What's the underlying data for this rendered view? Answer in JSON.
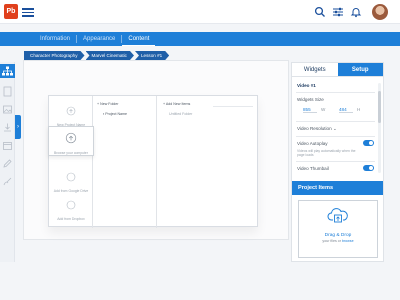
{
  "app": {
    "logo": "Pb"
  },
  "tabs": [
    "Information",
    "Appearance",
    "Content"
  ],
  "active_tab": "Content",
  "breadcrumb": [
    "Character Photography",
    "Marvel Cinematic",
    "Lesson #1"
  ],
  "canvas": {
    "cards": [
      {
        "label": "New Project Name",
        "icon": "upload-icon"
      },
      {
        "label": "Browse your computer",
        "icon": "upload-icon"
      },
      {
        "label": "Add from Google Drive",
        "icon": "drive-icon"
      },
      {
        "label": "Add from Dropbox",
        "icon": "dropbox-icon"
      }
    ],
    "col2": {
      "new_folder": "New Folder",
      "project_name": "Project Name"
    },
    "col3": {
      "add_new_items": "Add New Items",
      "untitled": "Untitled Folder"
    }
  },
  "panel": {
    "tabs": [
      "Widgets",
      "Setup"
    ],
    "active_tab": "Widgets",
    "video_title": "Video #1",
    "widget_size_label": "Widgets Size",
    "width_value": "855",
    "width_unit": "W",
    "height_value": "484",
    "height_unit": "H",
    "resolution_label": "Video Resolution",
    "autoplay_label": "Video Autoplay",
    "autoplay_desc": "Videos will play automatically when the page loads",
    "thumbnail_label": "Video Thumbail",
    "project_items_title": "Project Items",
    "drop_title": "Drag & Drop",
    "drop_sub": "your files or",
    "drop_link": "browse"
  },
  "colors": {
    "primary": "#1e7fd8",
    "breadcrumb": "#1f5fa8",
    "logo": "#e0401c"
  }
}
